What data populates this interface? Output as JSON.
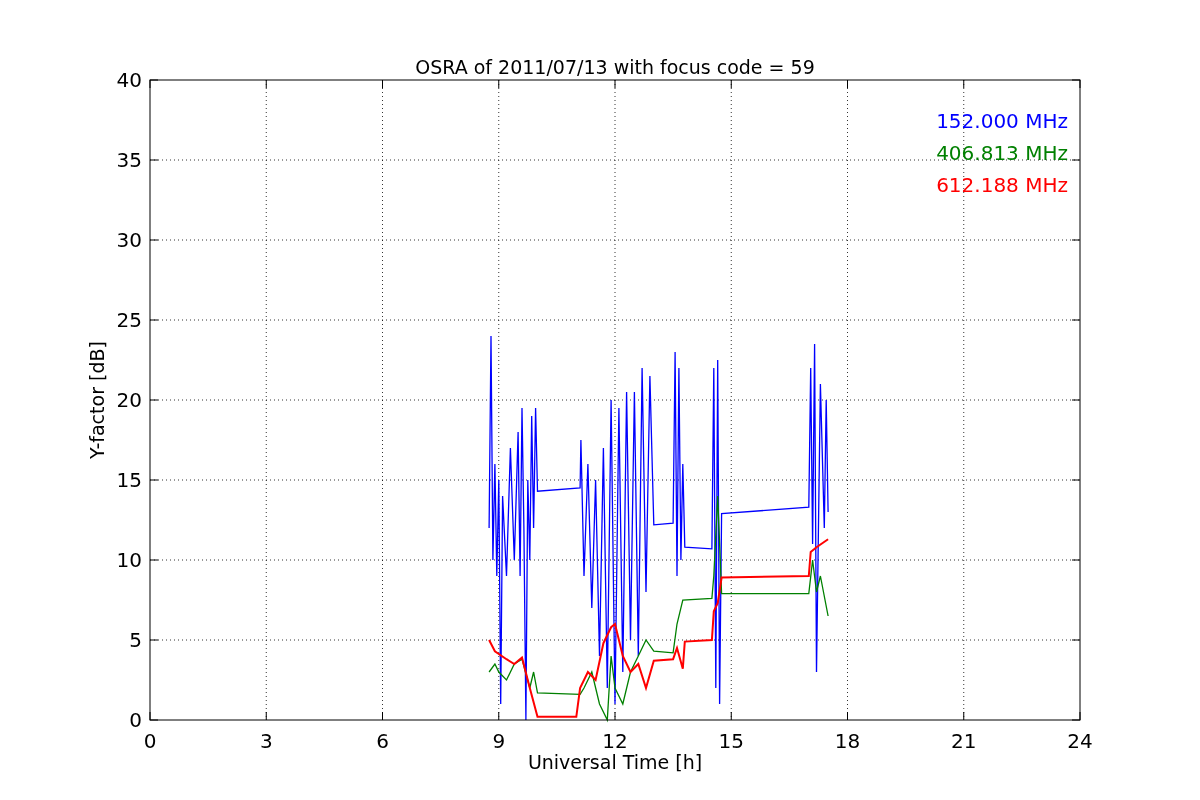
{
  "chart_data": {
    "type": "line",
    "title": "OSRA of 2011/07/13 with focus code = 59",
    "xlabel": "Universal Time [h]",
    "ylabel": "Y-factor [dB]",
    "xlim": [
      0,
      24
    ],
    "ylim": [
      0,
      40
    ],
    "xticks": [
      0,
      3,
      6,
      9,
      12,
      15,
      18,
      21,
      24
    ],
    "yticks": [
      0,
      5,
      10,
      15,
      20,
      25,
      30,
      35,
      40
    ],
    "grid": true,
    "series": [
      {
        "name": "152.000 MHz",
        "color": "#0000ff",
        "x": [
          8.75,
          8.8,
          8.85,
          8.9,
          8.95,
          9.0,
          9.05,
          9.1,
          9.2,
          9.3,
          9.4,
          9.5,
          9.55,
          9.6,
          9.65,
          9.7,
          9.75,
          9.8,
          9.85,
          9.9,
          9.95,
          10.0,
          11.1,
          11.12,
          11.2,
          11.3,
          11.4,
          11.5,
          11.6,
          11.7,
          11.8,
          11.9,
          12.0,
          12.1,
          12.2,
          12.3,
          12.4,
          12.5,
          12.6,
          12.7,
          12.8,
          12.9,
          13.0,
          13.5,
          13.55,
          13.6,
          13.65,
          13.7,
          13.75,
          13.8,
          14.5,
          14.55,
          14.6,
          14.65,
          14.7,
          14.75,
          17.0,
          17.05,
          17.1,
          17.15,
          17.2,
          17.3,
          17.4,
          17.45,
          17.5
        ],
        "values": [
          12,
          24,
          10,
          16,
          9,
          15,
          1,
          14,
          9,
          17,
          10,
          18,
          9,
          19.5,
          12,
          0,
          15,
          10,
          19,
          12,
          19.5,
          14.3,
          14.5,
          17.5,
          9,
          16,
          7,
          15,
          4,
          17,
          2,
          20,
          1,
          19.5,
          3,
          20.5,
          5,
          20.5,
          4,
          22,
          8,
          21.5,
          12.2,
          12.3,
          23,
          9,
          22,
          10,
          16,
          10.8,
          10.7,
          22,
          2,
          22.5,
          1,
          12.9,
          13.3,
          22,
          11,
          23.5,
          3,
          21,
          12,
          20,
          13
        ]
      },
      {
        "name": "406.813 MHz",
        "color": "#008000",
        "x": [
          8.75,
          8.9,
          9.0,
          9.2,
          9.4,
          9.6,
          9.8,
          9.9,
          10.0,
          11.1,
          11.2,
          11.4,
          11.6,
          11.8,
          11.9,
          12.0,
          12.2,
          12.4,
          12.6,
          12.8,
          13.0,
          13.5,
          13.6,
          13.75,
          14.5,
          14.55,
          14.65,
          14.75,
          17.0,
          17.1,
          17.2,
          17.3,
          17.5
        ],
        "values": [
          3,
          3.5,
          3,
          2.5,
          3.5,
          3.8,
          2,
          3,
          1.7,
          1.6,
          2,
          3,
          1,
          0,
          4,
          2,
          1,
          3,
          4,
          5,
          4.3,
          4.2,
          6,
          7.5,
          7.6,
          9,
          14,
          7.9,
          7.9,
          10,
          8,
          9,
          6.5
        ]
      },
      {
        "name": "612.188 MHz",
        "color": "#ff0000",
        "x": [
          8.75,
          8.9,
          9.2,
          9.4,
          9.6,
          9.8,
          10.0,
          11.0,
          11.1,
          11.3,
          11.5,
          11.7,
          11.9,
          12.0,
          12.2,
          12.4,
          12.6,
          12.8,
          13.0,
          13.5,
          13.6,
          13.75,
          13.8,
          14.5,
          14.55,
          14.65,
          14.75,
          17.0,
          17.05,
          17.2,
          17.5
        ],
        "values": [
          5,
          4.3,
          3.8,
          3.5,
          3.9,
          2,
          0.2,
          0.2,
          2,
          3,
          2.5,
          4.8,
          5.8,
          6,
          4,
          3,
          3.5,
          2,
          3.7,
          3.8,
          4.5,
          3.2,
          4.9,
          5,
          6.8,
          7.3,
          8.9,
          9,
          10.5,
          10.8,
          11.3
        ]
      }
    ]
  }
}
